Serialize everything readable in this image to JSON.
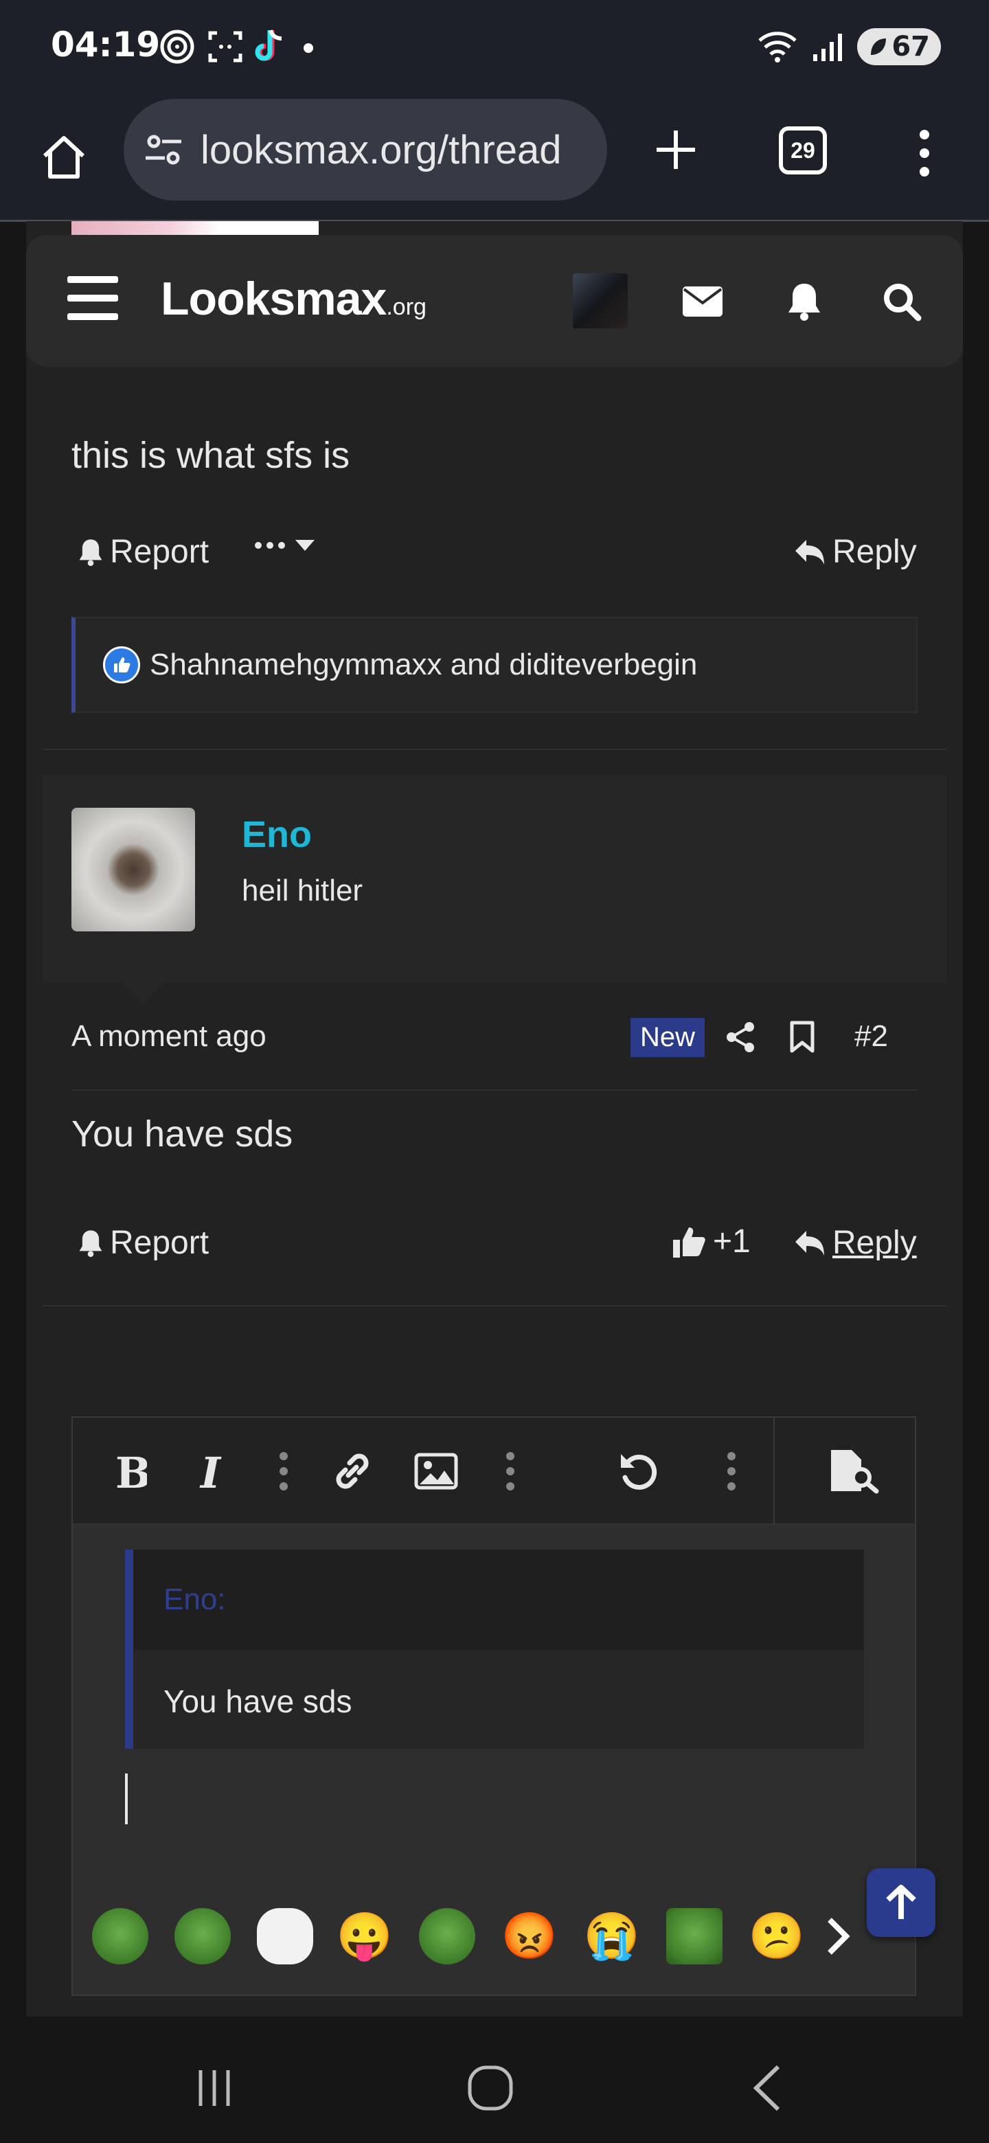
{
  "status_bar": {
    "time": "04:19",
    "notification_icons": [
      "signal-ring-icon",
      "screenshot-icon",
      "tiktok-icon",
      "dot-icon"
    ],
    "battery": "67"
  },
  "browser": {
    "url": "looksmax.org/thread",
    "tab_count": "29"
  },
  "site": {
    "logo_main": "Looksmax",
    "logo_suffix": ".org"
  },
  "posts": [
    {
      "body": "this is what sfs is",
      "report_label": "Report",
      "reply_label": "Reply",
      "reactions_text": "Shahnamehgymmaxx and diditeverbegin"
    },
    {
      "username": "Eno",
      "user_title": "heil hitler",
      "time": "A moment ago",
      "badge": "New",
      "post_number": "#2",
      "body": "You have sds",
      "report_label": "Report",
      "like_count": "+1",
      "reply_label": "Reply"
    }
  ],
  "editor": {
    "quote_author": "Eno:",
    "quote_body": "You have sds",
    "emojis": [
      "pepe-laugh",
      "pepe-tongue",
      "wojak",
      "😛",
      "pepe-angry",
      "😡",
      "😭",
      "pepe-smug",
      "😕"
    ]
  },
  "colors": {
    "accent": "#2c3a8a",
    "username": "#22b6d6",
    "like_blue": "#2c7be5"
  }
}
